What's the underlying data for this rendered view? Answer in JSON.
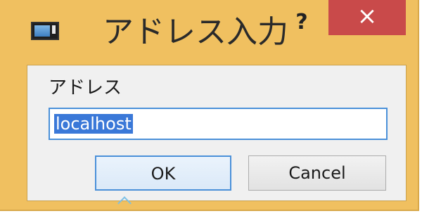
{
  "window": {
    "title": "アドレス入力",
    "help_label": "?",
    "close_label": "×",
    "frame_color": "#f0c060",
    "close_color": "#c94a4a"
  },
  "icons": {
    "app": "application-window-icon",
    "help": "help-icon",
    "close": "close-icon"
  },
  "form": {
    "address_label": "アドレス",
    "address_value": "localhost",
    "ok_label": "OK",
    "cancel_label": "Cancel"
  },
  "colors": {
    "selection": "#3a78d8",
    "focus_border": "#4a90d9"
  }
}
